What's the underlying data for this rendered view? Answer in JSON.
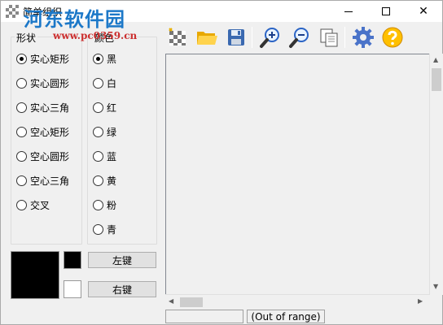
{
  "window": {
    "title": "简单组织",
    "controls": {
      "minimize": "",
      "maximize": "",
      "close": "✕"
    }
  },
  "watermark": {
    "site_name": "河东软件园",
    "site_url": "www.pc0359.cn"
  },
  "toolbar": {
    "items": [
      {
        "icon": "new-canvas-icon"
      },
      {
        "icon": "open-folder-icon"
      },
      {
        "icon": "save-disk-icon"
      },
      {
        "icon": "zoom-in-icon"
      },
      {
        "icon": "zoom-out-icon"
      },
      {
        "icon": "copy-pages-icon"
      },
      {
        "icon": "settings-gear-icon"
      },
      {
        "icon": "help-icon"
      }
    ]
  },
  "shape_group": {
    "label": "形状",
    "options": [
      "实心矩形",
      "实心圆形",
      "实心三角",
      "空心矩形",
      "空心圆形",
      "空心三角",
      "交叉"
    ],
    "selected_index": 0
  },
  "color_group": {
    "label": "颜色",
    "options": [
      "黑",
      "白",
      "红",
      "绿",
      "蓝",
      "黄",
      "粉",
      "青"
    ],
    "selected_index": 0
  },
  "colors": {
    "primary_preview": "#000000",
    "left_key_swatch": "#000000",
    "right_key_swatch": "#ffffff"
  },
  "buttons": {
    "left_key": "左键",
    "right_key": "右键"
  },
  "status": {
    "left": "",
    "right": "(Out of range)"
  }
}
